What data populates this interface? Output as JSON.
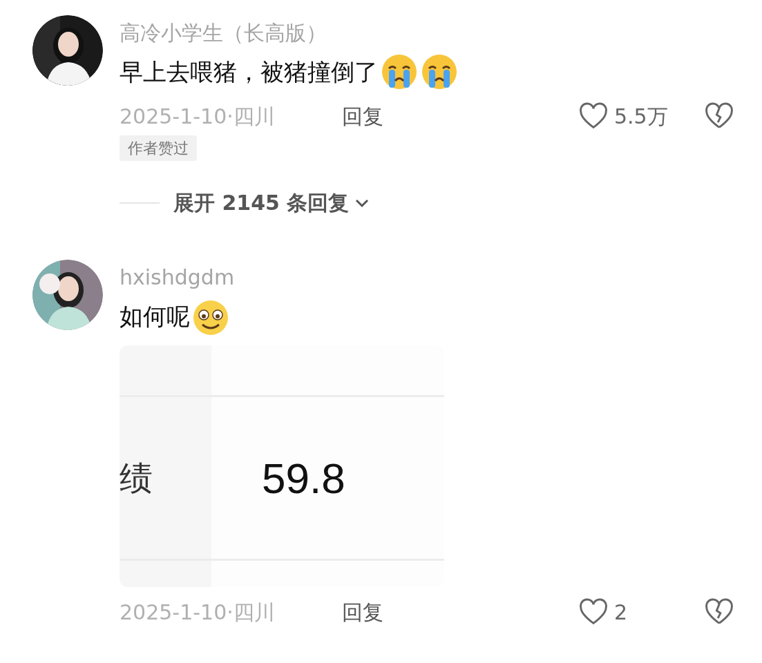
{
  "comments": [
    {
      "username": "高冷小学生（长高版）",
      "avatar": {
        "kind": "picture"
      },
      "text": "早上去喂猪，被猪撞倒了",
      "emojis": [
        {
          "kind": "crying"
        },
        {
          "kind": "crying"
        }
      ],
      "date": "2025-1-10·四川",
      "reply": "回复",
      "likes": "5.5万",
      "badge": "作者赞过",
      "expand": "展开 2145 条回复"
    },
    {
      "username": "hxishdgdm",
      "avatar": {
        "kind": "picture"
      },
      "text": "如何呢",
      "emojis": [
        {
          "kind": "smiling"
        }
      ],
      "image": {
        "label": "绩",
        "value": "59.8"
      },
      "date": "2025-1-10·四川",
      "reply": "回复",
      "likes": "2"
    }
  ]
}
